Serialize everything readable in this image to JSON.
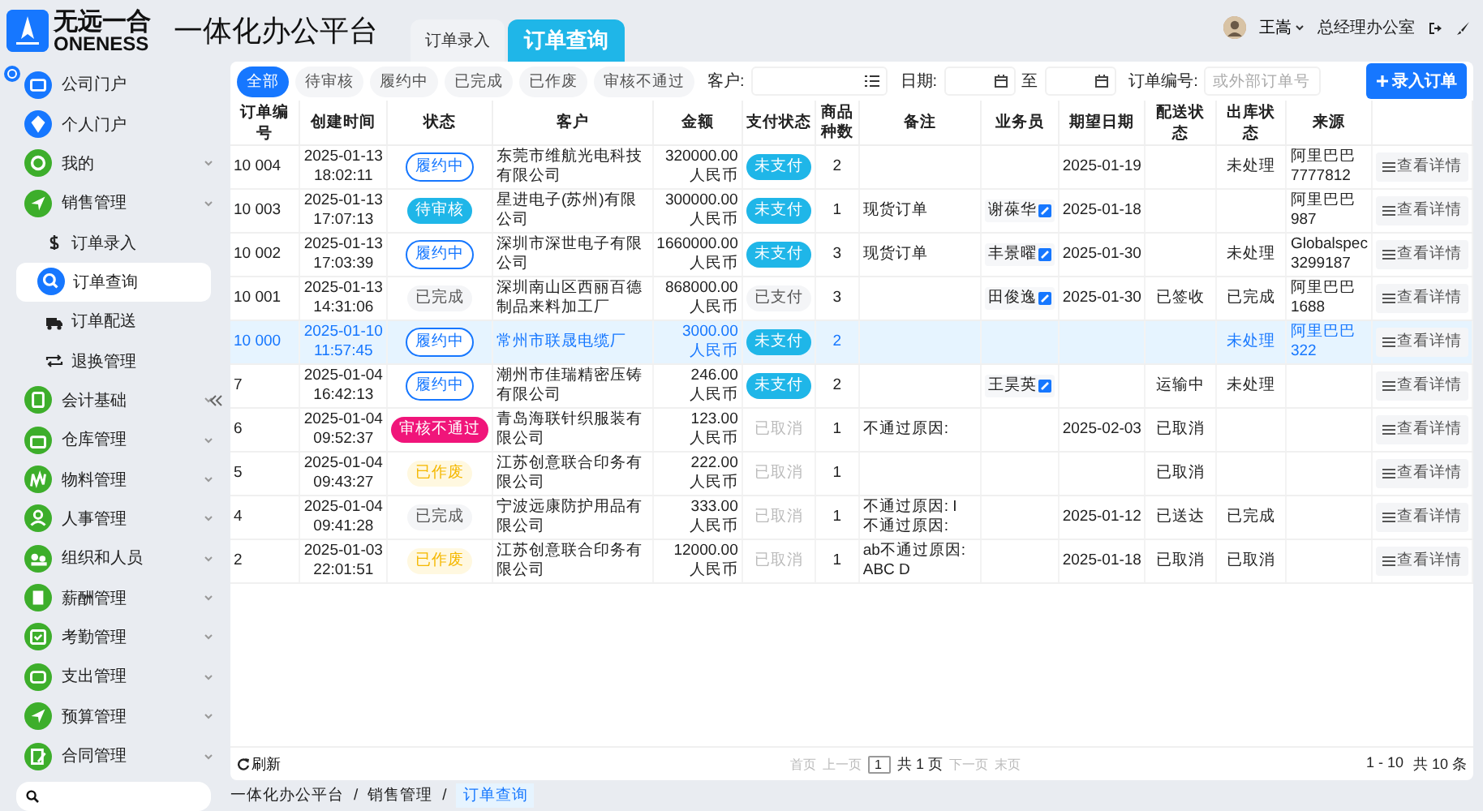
{
  "brand": {
    "logo_top": "无远一合",
    "logo_bottom": "ONENESS",
    "app_title": "一体化办公平台"
  },
  "top_tabs": [
    {
      "label": "订单录入",
      "selected": false
    },
    {
      "label": "订单查询",
      "selected": true
    }
  ],
  "user": {
    "name": "王嵩",
    "department": "总经理办公室"
  },
  "sidebar": {
    "items": [
      {
        "label": "公司门户",
        "color": "#1677ff",
        "expandable": false
      },
      {
        "label": "个人门户",
        "color": "#1677ff",
        "expandable": false
      },
      {
        "label": "我的",
        "color": "#3dae2b",
        "expandable": true
      },
      {
        "label": "销售管理",
        "color": "#3dae2b",
        "expandable": true,
        "children": [
          {
            "label": "订单录入",
            "selected": false
          },
          {
            "label": "订单查询",
            "selected": true
          },
          {
            "label": "订单配送",
            "selected": false
          },
          {
            "label": "退换管理",
            "selected": false
          }
        ]
      },
      {
        "label": "会计基础",
        "color": "#3dae2b",
        "expandable": true
      },
      {
        "label": "仓库管理",
        "color": "#3dae2b",
        "expandable": true
      },
      {
        "label": "物料管理",
        "color": "#3dae2b",
        "expandable": true
      },
      {
        "label": "人事管理",
        "color": "#3dae2b",
        "expandable": true
      },
      {
        "label": "组织和人员",
        "color": "#3dae2b",
        "expandable": true
      },
      {
        "label": "薪酬管理",
        "color": "#3dae2b",
        "expandable": true
      },
      {
        "label": "考勤管理",
        "color": "#3dae2b",
        "expandable": true
      },
      {
        "label": "支出管理",
        "color": "#3dae2b",
        "expandable": true
      },
      {
        "label": "预算管理",
        "color": "#3dae2b",
        "expandable": true
      },
      {
        "label": "合同管理",
        "color": "#3dae2b",
        "expandable": true
      }
    ]
  },
  "filters": {
    "status_tabs": [
      {
        "label": "全部",
        "selected": true
      },
      {
        "label": "待审核",
        "selected": false
      },
      {
        "label": "履约中",
        "selected": false
      },
      {
        "label": "已完成",
        "selected": false
      },
      {
        "label": "已作废",
        "selected": false
      },
      {
        "label": "审核不通过",
        "selected": false
      }
    ],
    "customer_label": "客户:",
    "date_label": "日期:",
    "date_separator": "至",
    "order_label": "订单编号:",
    "order_placeholder": "或外部订单号",
    "add_button": "录入订单"
  },
  "table": {
    "columns": [
      "订单编号",
      "创建时间",
      "状态",
      "客户",
      "金额",
      "支付状态",
      "商品种数",
      "备注",
      "业务员",
      "期望日期",
      "配送状态",
      "出库状态",
      "来源"
    ],
    "rows": [
      {
        "selected": false,
        "id": "10 004",
        "date": "2025-01-13",
        "time": "18:02:11",
        "status": {
          "label": "履约中",
          "kind": "active"
        },
        "customer": "东莞市维航光电科技有限公司",
        "amount": "320000.00",
        "currency": "人民币",
        "payment": {
          "label": "未支付",
          "kind": "unpaid"
        },
        "count": "2",
        "memo": "",
        "salesperson": "",
        "expected": "2025-01-19",
        "delivery": "",
        "outbound": "未处理",
        "source": "阿里巴巴",
        "source_no": "7777812",
        "action": "查看详情"
      },
      {
        "selected": false,
        "id": "10 003",
        "date": "2025-01-13",
        "time": "17:07:13",
        "status": {
          "label": "待审核",
          "kind": "pending"
        },
        "customer": "星进电子(苏州)有限公司",
        "amount": "300000.00",
        "currency": "人民币",
        "payment": {
          "label": "未支付",
          "kind": "unpaid"
        },
        "count": "1",
        "memo": "现货订单",
        "salesperson": "谢葆华",
        "expected": "2025-01-18",
        "delivery": "",
        "outbound": "",
        "source": "阿里巴巴",
        "source_no": "987",
        "action": "查看详情"
      },
      {
        "selected": false,
        "id": "10 002",
        "date": "2025-01-13",
        "time": "17:03:39",
        "status": {
          "label": "履约中",
          "kind": "active"
        },
        "customer": "深圳市深世电子有限公司",
        "amount": "1660000.00",
        "currency": "人民币",
        "payment": {
          "label": "未支付",
          "kind": "unpaid"
        },
        "count": "3",
        "memo": "现货订单",
        "salesperson": "丰景曜",
        "expected": "2025-01-30",
        "delivery": "",
        "outbound": "未处理",
        "source": "Globalspec",
        "source_no": "3299187",
        "action": "查看详情"
      },
      {
        "selected": false,
        "id": "10 001",
        "date": "2025-01-13",
        "time": "14:31:06",
        "status": {
          "label": "已完成",
          "kind": "done"
        },
        "customer": "深圳南山区西丽百德制品来料加工厂",
        "amount": "868000.00",
        "currency": "人民币",
        "payment": {
          "label": "已支付",
          "kind": "paid"
        },
        "count": "3",
        "memo": "",
        "salesperson": "田俊逸",
        "expected": "2025-01-30",
        "delivery": "已签收",
        "outbound": "已完成",
        "source": "阿里巴巴",
        "source_no": "1688",
        "action": "查看详情"
      },
      {
        "selected": true,
        "id": "10 000",
        "date": "2025-01-10",
        "time": "11:57:45",
        "status": {
          "label": "履约中",
          "kind": "active"
        },
        "customer": "常州市联晟电缆厂",
        "amount": "3000.00",
        "currency": "人民币",
        "payment": {
          "label": "未支付",
          "kind": "unpaid"
        },
        "count": "2",
        "memo": "",
        "salesperson": "",
        "expected": "",
        "delivery": "",
        "outbound": "未处理",
        "source": "阿里巴巴",
        "source_no": "322",
        "action": "查看详情"
      },
      {
        "selected": false,
        "id": "7",
        "date": "2025-01-04",
        "time": "16:42:13",
        "status": {
          "label": "履约中",
          "kind": "active"
        },
        "customer": "潮州市佳瑞精密压铸有限公司",
        "amount": "246.00",
        "currency": "人民币",
        "payment": {
          "label": "未支付",
          "kind": "unpaid"
        },
        "count": "2",
        "memo": "",
        "salesperson": "王昊英",
        "expected": "",
        "delivery": "运输中",
        "outbound": "未处理",
        "source": "",
        "source_no": "",
        "action": "查看详情"
      },
      {
        "selected": false,
        "id": "6",
        "date": "2025-01-04",
        "time": "09:52:37",
        "status": {
          "label": "审核不通过",
          "kind": "rejected"
        },
        "customer": "青岛海联针织服装有限公司",
        "amount": "123.00",
        "currency": "人民币",
        "payment": {
          "label": "已取消",
          "kind": "cancelled"
        },
        "count": "1",
        "memo": "不通过原因:",
        "salesperson": "",
        "expected": "2025-02-03",
        "delivery": "已取消",
        "outbound": "",
        "source": "",
        "source_no": "",
        "action": "查看详情"
      },
      {
        "selected": false,
        "id": "5",
        "date": "2025-01-04",
        "time": "09:43:27",
        "status": {
          "label": "已作废",
          "kind": "voided"
        },
        "customer": "江苏创意联合印务有限公司",
        "amount": "222.00",
        "currency": "人民币",
        "payment": {
          "label": "已取消",
          "kind": "cancelled"
        },
        "count": "1",
        "memo": "",
        "salesperson": "",
        "expected": "",
        "delivery": "已取消",
        "outbound": "",
        "source": "",
        "source_no": "",
        "action": "查看详情"
      },
      {
        "selected": false,
        "id": "4",
        "date": "2025-01-04",
        "time": "09:41:28",
        "status": {
          "label": "已完成",
          "kind": "done"
        },
        "customer": "宁波远康防护用品有限公司",
        "amount": "333.00",
        "currency": "人民币",
        "payment": {
          "label": "已取消",
          "kind": "cancelled"
        },
        "count": "1",
        "memo": "不通过原因: I 不通过原因:",
        "salesperson": "",
        "expected": "2025-01-12",
        "delivery": "已送达",
        "outbound": "已完成",
        "source": "",
        "source_no": "",
        "action": "查看详情"
      },
      {
        "selected": false,
        "id": "2",
        "date": "2025-01-03",
        "time": "22:01:51",
        "status": {
          "label": "已作废",
          "kind": "voided"
        },
        "customer": "江苏创意联合印务有限公司",
        "amount": "12000.00",
        "currency": "人民币",
        "payment": {
          "label": "已取消",
          "kind": "cancelled"
        },
        "count": "1",
        "memo": "ab不通过原因: ABC D",
        "salesperson": "",
        "expected": "2025-01-18",
        "delivery": "已取消",
        "outbound": "已取消",
        "source": "",
        "source_no": "",
        "action": "查看详情"
      }
    ]
  },
  "footer": {
    "refresh": "刷新",
    "first": "首页",
    "prev": "上一页",
    "page": "1",
    "total_pages": "共 1 页",
    "next": "下一页",
    "last": "末页",
    "range": "1 - 10",
    "total": "共 10 条"
  },
  "breadcrumb": {
    "separator": "/",
    "items": [
      "一体化办公平台",
      "销售管理",
      "订单查询"
    ]
  }
}
